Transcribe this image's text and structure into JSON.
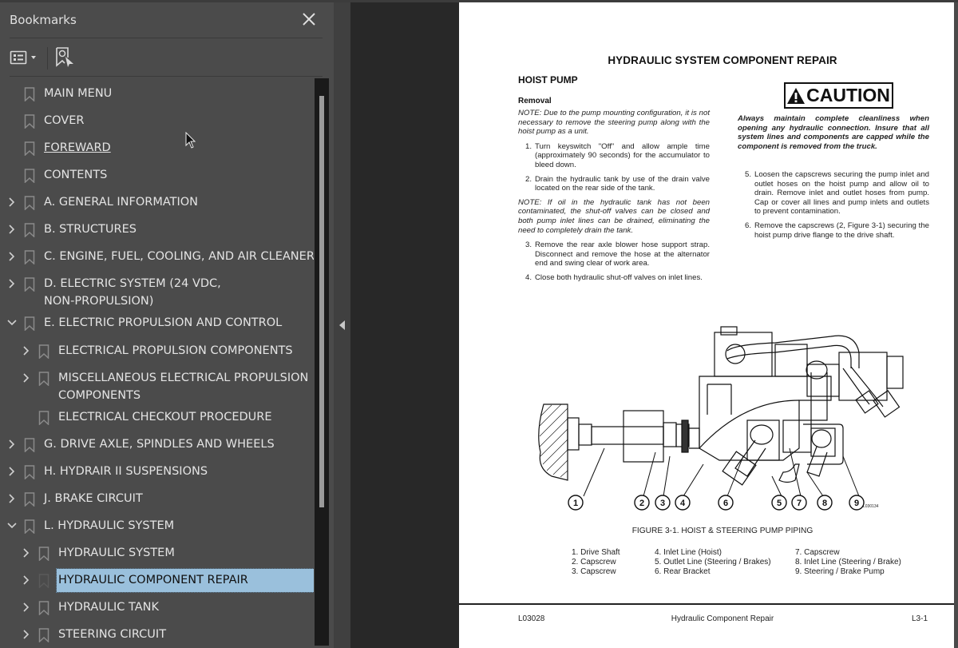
{
  "bookmarks_panel": {
    "title": "Bookmarks",
    "close_icon": "close-icon",
    "toolbar": {
      "options_icon": "list-options-icon",
      "find_icon": "find-current-bookmark-icon"
    },
    "items": [
      {
        "label": "MAIN MENU",
        "level": 0,
        "expandable": false
      },
      {
        "label": "COVER",
        "level": 0,
        "expandable": false
      },
      {
        "label": "FOREWARD",
        "level": 0,
        "expandable": false,
        "hovered": true
      },
      {
        "label": "CONTENTS",
        "level": 0,
        "expandable": false
      },
      {
        "label": "A. GENERAL INFORMATION",
        "level": 0,
        "expandable": true,
        "expanded": false
      },
      {
        "label": "B. STRUCTURES",
        "level": 0,
        "expandable": true,
        "expanded": false
      },
      {
        "label": "C. ENGINE, FUEL, COOLING, AND AIR CLEANER",
        "level": 0,
        "expandable": true,
        "expanded": false
      },
      {
        "label": "D. ELECTRIC SYSTEM (24 VDC, NON-PROPULSION)",
        "level": 0,
        "expandable": true,
        "expanded": false
      },
      {
        "label": "E. ELECTRIC PROPULSION AND CONTROL",
        "level": 0,
        "expandable": true,
        "expanded": true
      },
      {
        "label": "ELECTRICAL PROPULSION COMPONENTS",
        "level": 1,
        "expandable": true,
        "expanded": false
      },
      {
        "label": "MISCELLANEOUS ELECTRICAL PROPULSION COMPONENTS",
        "level": 1,
        "expandable": true,
        "expanded": false
      },
      {
        "label": "ELECTRICAL CHECKOUT PROCEDURE",
        "level": 1,
        "expandable": false
      },
      {
        "label": "G. DRIVE AXLE, SPINDLES AND WHEELS",
        "level": 0,
        "expandable": true,
        "expanded": false
      },
      {
        "label": "H. HYDRAIR II SUSPENSIONS",
        "level": 0,
        "expandable": true,
        "expanded": false
      },
      {
        "label": "J. BRAKE CIRCUIT",
        "level": 0,
        "expandable": true,
        "expanded": false
      },
      {
        "label": "L. HYDRAULIC SYSTEM",
        "level": 0,
        "expandable": true,
        "expanded": true
      },
      {
        "label": "HYDRAULIC SYSTEM",
        "level": 1,
        "expandable": true,
        "expanded": false
      },
      {
        "label": "HYDRAULIC COMPONENT REPAIR",
        "level": 1,
        "expandable": true,
        "expanded": false,
        "selected": true
      },
      {
        "label": "HYDRAULIC TANK",
        "level": 1,
        "expandable": true,
        "expanded": false
      },
      {
        "label": "STEERING CIRCUIT",
        "level": 1,
        "expandable": true,
        "expanded": false
      }
    ],
    "selection_color": "#9ac0dc"
  },
  "splitter": {
    "collapse_icon": "collapse-left-arrow-icon"
  },
  "document": {
    "title": "HYDRAULIC SYSTEM COMPONENT REPAIR",
    "section_heading": "HOIST PUMP",
    "subheading": "Removal",
    "note1": "NOTE: Due to the pump mounting configuration, it is not necessary to remove the steering pump along with the hoist pump as a unit.",
    "steps_left": [
      {
        "num": "1.",
        "text": "Turn keyswitch \"Off\" and allow ample time (approximately 90 seconds) for the accumulator to bleed down."
      },
      {
        "num": "2.",
        "text": "Drain the hydraulic tank by use of the drain valve located on the rear side of the tank."
      }
    ],
    "note2": "NOTE: If oil in the hydraulic tank has not been contaminated, the shut-off valves can be closed and both pump inlet lines can be drained, eliminating the need to completely drain the tank.",
    "steps_left2": [
      {
        "num": "3.",
        "text": "Remove the rear axle blower hose support strap. Disconnect and remove the hose at the alternator end and swing clear of work area."
      },
      {
        "num": "4.",
        "text": "Close both hydraulic shut-off valves on inlet lines."
      }
    ],
    "caution_label": "CAUTION",
    "caution_text": "Always maintain complete cleanliness when opening any hydraulic connection. Insure that all system lines and components are capped while the component is removed from the truck.",
    "steps_right": [
      {
        "num": "5.",
        "text": "Loosen the capscrews securing the pump inlet and outlet hoses on the hoist pump and allow oil to drain. Remove inlet and outlet hoses from pump. Cap or cover all lines and pump inlets and outlets to prevent contamination."
      },
      {
        "num": "6.",
        "text": "Remove the capscrews (2, Figure 3-1) securing the hoist pump drive flange to the drive shaft."
      }
    ],
    "figure": {
      "callouts": [
        "1",
        "2",
        "3",
        "4",
        "6",
        "5",
        "7",
        "8",
        "9"
      ],
      "code": "L030134",
      "caption": "FIGURE 3-1. HOIST & STEERING PUMP PIPING",
      "legend": [
        [
          "1. Drive Shaft",
          "2. Capscrew",
          "3. Capscrew"
        ],
        [
          "4. Inlet Line (Hoist)",
          "5. Outlet Line (Steering / Brakes)",
          "6. Rear Bracket"
        ],
        [
          "7. Capscrew",
          "8. Inlet Line (Steering  / Brake)",
          "9. Steering / Brake Pump"
        ]
      ]
    },
    "footer": {
      "left": "L03028",
      "center": "Hydraulic Component Repair",
      "right": "L3-1"
    }
  }
}
